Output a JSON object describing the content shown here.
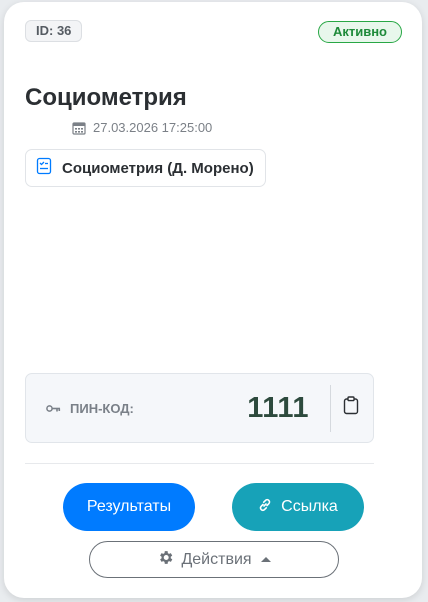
{
  "card": {
    "id_label": "ID: 36",
    "status": "Активно",
    "title": "Социометрия",
    "datetime": "27.03.2026 17:25:00",
    "method": "Социометрия (Д. Морено)"
  },
  "pin": {
    "label": "ПИН-КОД:",
    "value": "1111"
  },
  "buttons": {
    "results": "Результаты",
    "link": "Ссылка",
    "actions": "Действия"
  },
  "colors": {
    "primary": "#007bff",
    "info": "#17a2b8",
    "success": "#28a745",
    "secondary": "#6b7178"
  },
  "icons": {
    "date": "calendar-icon",
    "method": "checklist-icon",
    "pin": "key-icon",
    "copy": "clipboard-icon",
    "link": "link-icon",
    "actions": "gear-icon",
    "caret": "caret-up-icon"
  }
}
